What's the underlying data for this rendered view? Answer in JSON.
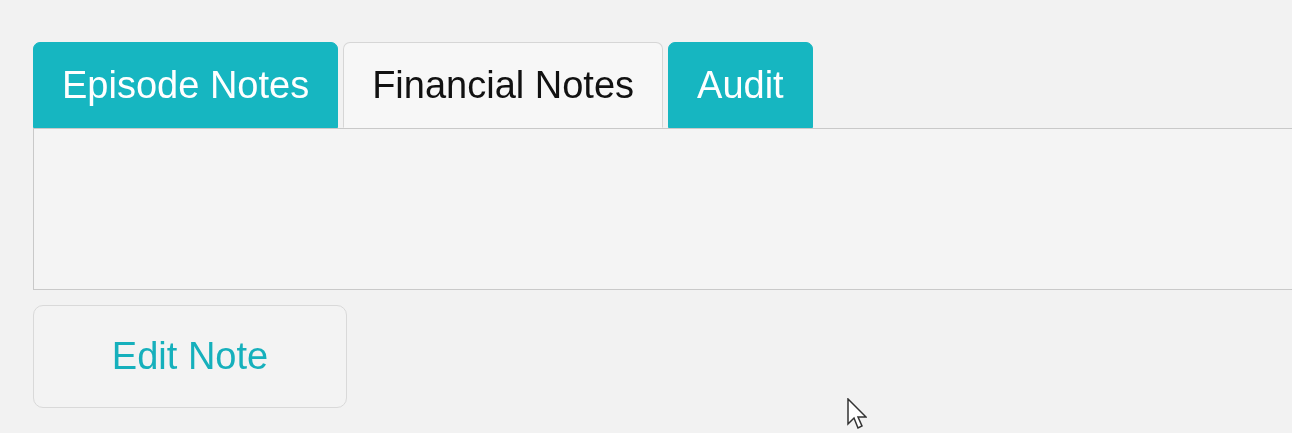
{
  "tabs": [
    {
      "label": "Episode Notes",
      "selected": false
    },
    {
      "label": "Financial Notes",
      "selected": true
    },
    {
      "label": "Audit",
      "selected": false
    }
  ],
  "buttons": [
    {
      "label": "Edit Note"
    }
  ]
}
